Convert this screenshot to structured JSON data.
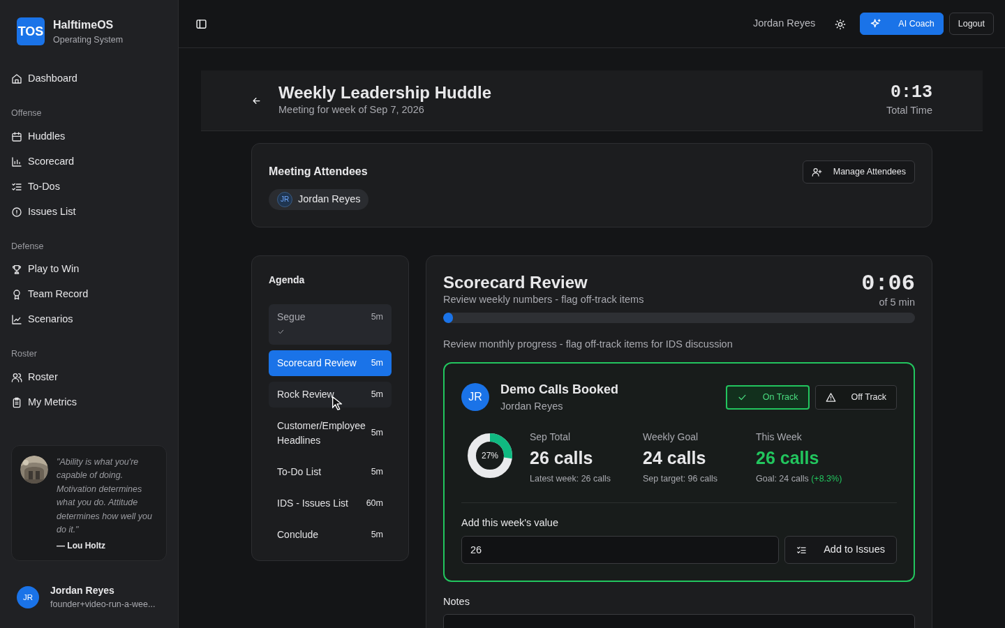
{
  "sidebar": {
    "logo": {
      "mark": "TOS",
      "name": "HalftimeOS",
      "tagline": "Operating System"
    },
    "sections": [
      {
        "items": [
          {
            "label": "Dashboard"
          }
        ]
      },
      {
        "title": "Offense",
        "items": [
          {
            "label": "Huddles"
          },
          {
            "label": "Scorecard"
          },
          {
            "label": "To-Dos"
          },
          {
            "label": "Issues List"
          }
        ]
      },
      {
        "title": "Defense",
        "items": [
          {
            "label": "Play to Win"
          },
          {
            "label": "Team Record"
          },
          {
            "label": "Scenarios"
          }
        ]
      },
      {
        "title": "Roster",
        "items": [
          {
            "label": "Roster"
          },
          {
            "label": "My Metrics"
          }
        ]
      }
    ],
    "quote": {
      "text": "\"Ability is what you're capable of doing. Motivation determines what you do. Attitude determines how well you do it.\"",
      "author": "— Lou Holtz"
    },
    "user": {
      "initials": "JR",
      "name": "Jordan Reyes",
      "email": "founder+video-run-a-wee..."
    }
  },
  "topbar": {
    "user_name": "Jordan Reyes",
    "ai_button": "AI Coach",
    "logout": "Logout"
  },
  "meeting": {
    "title": "Weekly Leadership Huddle",
    "subtitle": "Meeting for week of Sep 7, 2026",
    "timer": "0:13",
    "timer_label": "Total Time"
  },
  "attendees": {
    "title": "Meeting Attendees",
    "manage_button": "Manage Attendees",
    "people": [
      {
        "initials": "JR",
        "name": "Jordan Reyes"
      }
    ]
  },
  "agenda": {
    "title": "Agenda",
    "items": [
      {
        "label": "Segue",
        "duration": "5m",
        "selected": false,
        "completed": true,
        "hovered": false
      },
      {
        "label": "Scorecard Review",
        "duration": "5m",
        "selected": true,
        "completed": false,
        "hovered": false
      },
      {
        "label": "Rock Review",
        "duration": "5m",
        "selected": false,
        "completed": false,
        "hovered": true
      },
      {
        "label": "Customer/Employee Headlines",
        "duration": "5m",
        "selected": false,
        "completed": false,
        "hovered": false
      },
      {
        "label": "To-Do List",
        "duration": "5m",
        "selected": false,
        "completed": false,
        "hovered": false
      },
      {
        "label": "IDS - Issues List",
        "duration": "60m",
        "selected": false,
        "completed": false,
        "hovered": false
      },
      {
        "label": "Conclude",
        "duration": "5m",
        "selected": false,
        "completed": false,
        "hovered": false
      }
    ]
  },
  "section": {
    "title": "Scorecard Review",
    "subtitle": "Review weekly numbers - flag off-track items",
    "timer": "0:06",
    "timer_label": "of 5 min",
    "level": 0.02,
    "description": "Review monthly progress - flag off-track items for IDS discussion"
  },
  "metric": {
    "name": "Demo Calls Booked",
    "owner": "Jordan Reyes",
    "initials": "JR",
    "statuses": [
      {
        "label": "On Track",
        "kind": "on",
        "selected": true
      },
      {
        "label": "Off Track",
        "kind": "off",
        "selected": false
      }
    ],
    "donut": {
      "label": "27%",
      "level": 0.27
    },
    "stats": [
      {
        "label": "Sep Total",
        "value": "26 calls",
        "note": "Latest week: 26 calls",
        "highlight": false
      },
      {
        "label": "Weekly Goal",
        "value": "24 calls",
        "note": "Sep target: 96 calls",
        "highlight": false
      },
      {
        "label": "This Week",
        "value": "26 calls",
        "note": "Goal: 24 calls",
        "delta": "(+8.3%)",
        "highlight": true
      }
    ],
    "input_label": "Add this week's value",
    "value": "26",
    "issues_button": "Add to Issues"
  },
  "notes": {
    "label": "Notes"
  }
}
